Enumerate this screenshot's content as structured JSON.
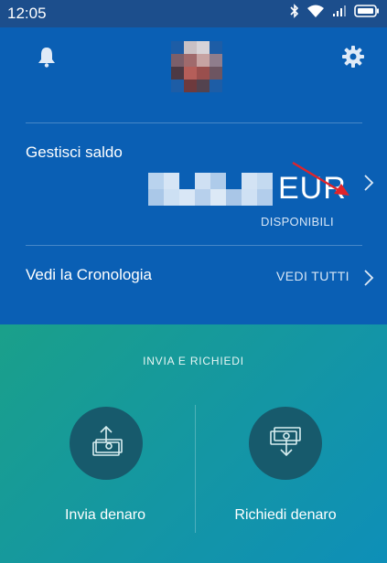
{
  "status_bar": {
    "time": "12:05"
  },
  "header": {
    "notifications_icon": "bell-icon",
    "settings_icon": "gear-icon"
  },
  "balance": {
    "title": "Gestisci saldo",
    "currency": "EUR",
    "status": "DISPONIBILI"
  },
  "history": {
    "title": "Vedi la Cronologia",
    "see_all": "VEDI TUTTI"
  },
  "transfer": {
    "section_title": "INVIA E RICHIEDI",
    "send_label": "Invia denaro",
    "request_label": "Richiedi denaro"
  },
  "colors": {
    "top_panel": "#0a5fb4",
    "status_bar": "#1c4e8c",
    "bottom_gradient_start": "#1aa08a",
    "bottom_gradient_end": "#0e8fb8",
    "action_circle": "#175a6c",
    "annotation_arrow": "#e0242b"
  }
}
